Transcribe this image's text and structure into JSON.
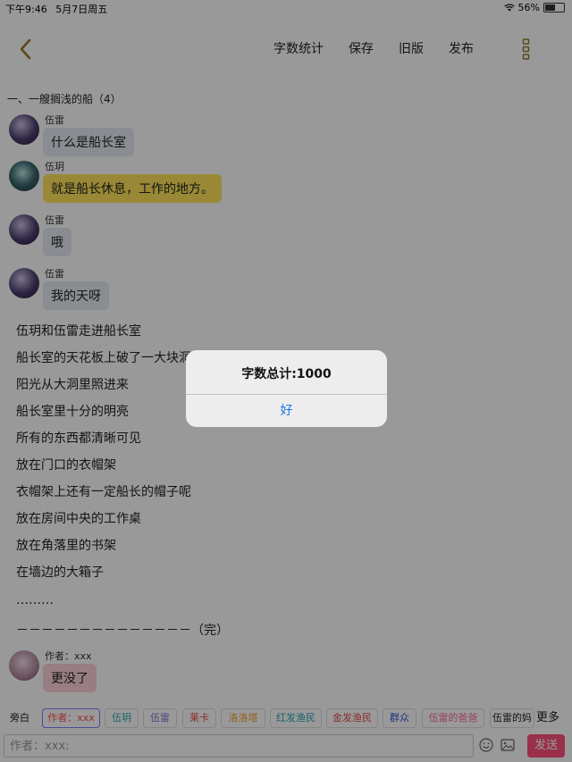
{
  "status_bar": {
    "time": "下午9:46",
    "date": "5月7日周五",
    "battery": "56%",
    "battery_level": 0.56
  },
  "nav": {
    "word_count": "字数统计",
    "save": "保存",
    "old_version": "旧版",
    "publish": "发布"
  },
  "chapter_title": "一、一艘搁浅的船（4）",
  "messages": [
    {
      "sender": "伍雷",
      "text": "什么是船长室"
    },
    {
      "sender": "伍玥",
      "text": "就是船长休息，工作的地方。"
    },
    {
      "sender": "伍雷",
      "text": "哦"
    },
    {
      "sender": "伍雷",
      "text": "我的天呀"
    }
  ],
  "narration": [
    "伍玥和伍雷走进船长室",
    "船长室的天花板上破了一大块洞",
    "阳光从大洞里照进来",
    "船长室里十分的明亮",
    "所有的东西都清晰可见",
    "放在门口的衣帽架",
    "衣帽架上还有一定船长的帽子呢",
    "放在房间中央的工作桌",
    "放在角落里的书架",
    "在墙边的大箱子",
    "………",
    "－－－－－－－－－－－－－－（完）"
  ],
  "author_message": {
    "sender": "作者：xxx",
    "text": "更没了"
  },
  "tags": [
    "旁白",
    "作者：xxx",
    "伍玥",
    "伍雷",
    "莱卡",
    "洛洛塔",
    "红发渔民",
    "金发渔民",
    "群众",
    "伍雷的爸爸",
    "伍雷的妈"
  ],
  "tags_more": "更多",
  "input": {
    "placeholder": "作者：xxx:"
  },
  "send_label": "发送",
  "dialog": {
    "message": "字数总计:1000",
    "ok": "好"
  },
  "colors": {
    "accent": "#ff4f7c",
    "dialog_button": "#1775e6",
    "yellow_bubble": "#ffe45a",
    "gray_bubble": "#e4ecf3",
    "pink_bubble": "#fdd2db"
  }
}
